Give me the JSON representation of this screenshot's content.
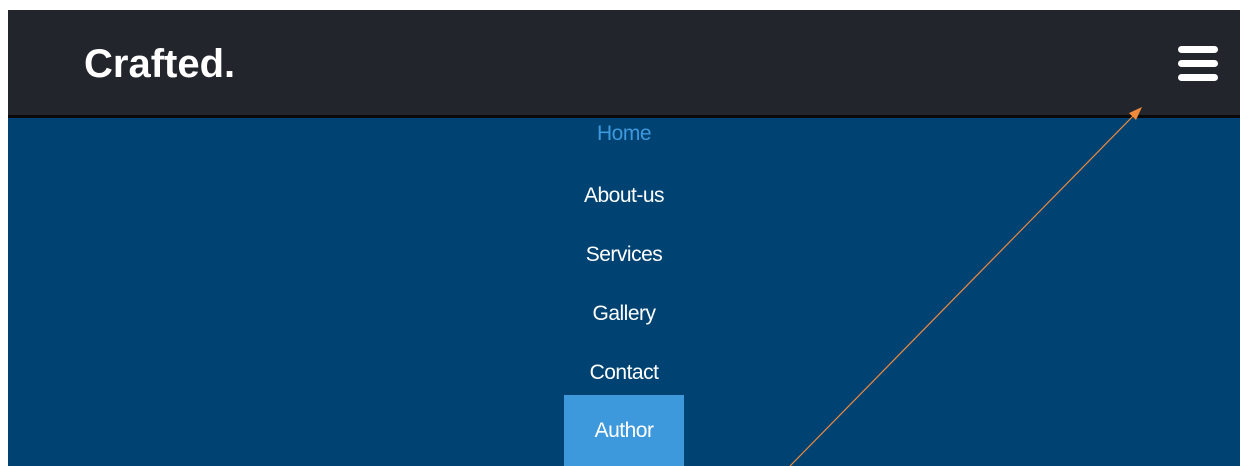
{
  "navbar": {
    "brand": "Crafted.",
    "menu_toggle_icon": "hamburger-menu-icon"
  },
  "menu": {
    "items": [
      {
        "label": "Home",
        "state": "active"
      },
      {
        "label": "About-us",
        "state": "normal"
      },
      {
        "label": "Services",
        "state": "normal"
      },
      {
        "label": "Gallery",
        "state": "normal"
      },
      {
        "label": "Contact",
        "state": "normal"
      },
      {
        "label": "Author",
        "state": "highlighted"
      }
    ]
  },
  "colors": {
    "navbar_bg": "#22252b",
    "menu_bg": "#004373",
    "accent": "#3d98dc",
    "annotation_arrow": "#f08a3c"
  }
}
